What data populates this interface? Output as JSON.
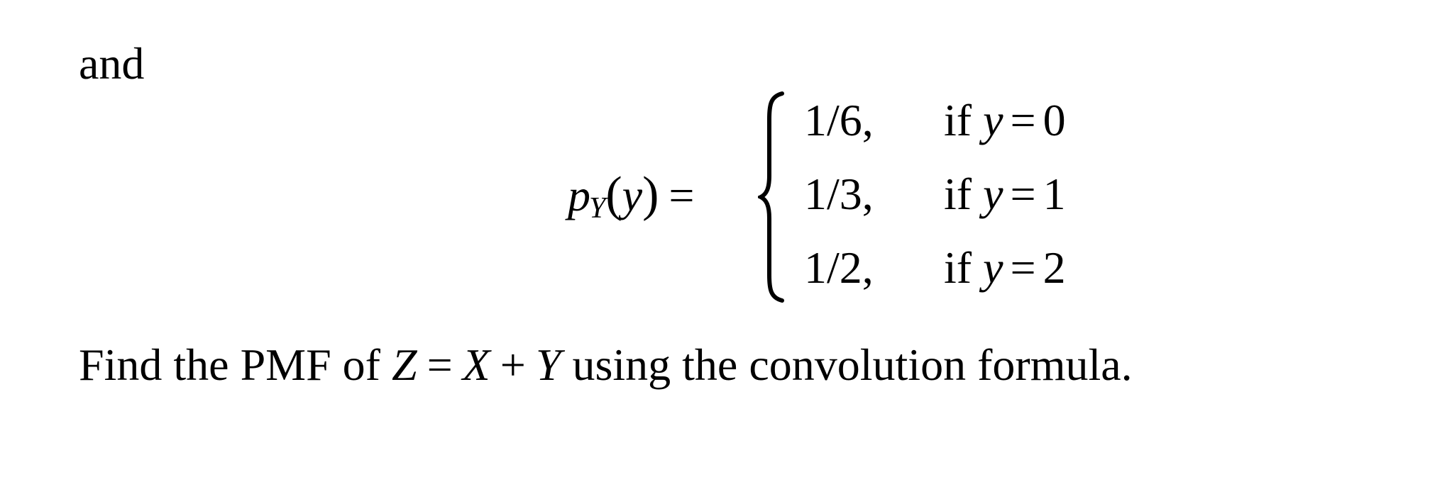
{
  "document": {
    "intro_word": "and",
    "equation": {
      "lhs_function": "p",
      "lhs_subscript": "Y",
      "lhs_open_paren": "(",
      "lhs_argument": "y",
      "lhs_close_paren": ")",
      "equals": "=",
      "cases": [
        {
          "value": "1/6,",
          "keyword": "if",
          "variable": "y",
          "relation": "=",
          "condition_value": "0"
        },
        {
          "value": "1/3,",
          "keyword": "if",
          "variable": "y",
          "relation": "=",
          "condition_value": "1"
        },
        {
          "value": "1/2,",
          "keyword": "if",
          "variable": "y",
          "relation": "=",
          "condition_value": "2"
        }
      ]
    },
    "question": {
      "prefix": "Find the PMF of",
      "z": "Z",
      "equals": "=",
      "x": "X",
      "plus": "+",
      "y": "Y",
      "suffix": "using the convolution formula."
    }
  }
}
